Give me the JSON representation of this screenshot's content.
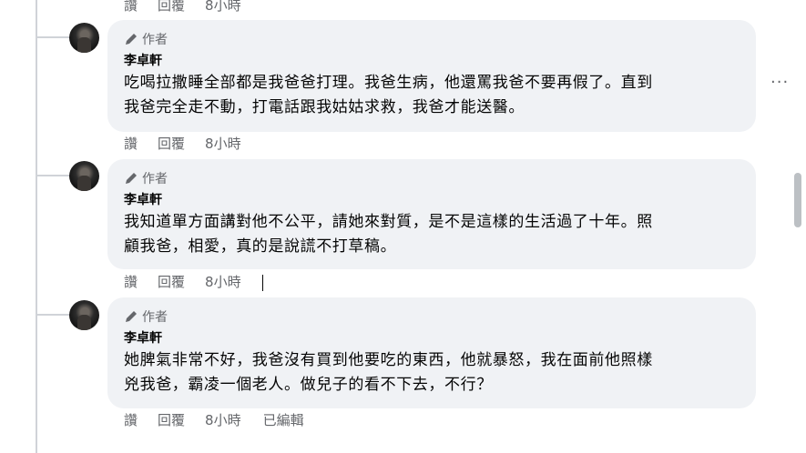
{
  "actions": {
    "like": "讚",
    "reply": "回覆"
  },
  "top_actions": {
    "time": "8小時"
  },
  "author_badge": "作者",
  "more_menu": "···",
  "comments": [
    {
      "name": "李卓軒",
      "line1": "吃喝拉撒睡全部都是我爸爸打理。我爸生病，他還罵我爸不要再假了。直到",
      "line2": "我爸完全走不動，打電話跟我姑姑求救，我爸才能送醫。",
      "time": "8小時"
    },
    {
      "name": "李卓軒",
      "line1": "我知道單方面講對他不公平，請她來對質，是不是這樣的生活過了十年。照",
      "line2": "顧我爸，相愛，真的是說謊不打草稿。",
      "time": "8小時"
    },
    {
      "name": "李卓軒",
      "line1": "她脾氣非常不好，我爸沒有買到他要吃的東西，他就暴怒，我在面前他照樣",
      "line2": "兇我爸，霸凌一個老人。做兒子的看不下去，不行？",
      "time": "8小時",
      "edited": "已編輯"
    }
  ],
  "colors": {
    "bubble": "#f0f2f5",
    "meta": "#65676b",
    "thread": "#d0d3d8"
  }
}
